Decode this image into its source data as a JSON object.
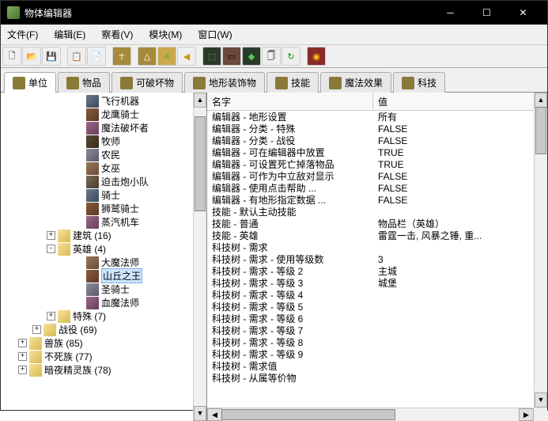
{
  "window": {
    "title": "物体编辑器"
  },
  "menu": {
    "file": "文件(F)",
    "edit": "编辑(E)",
    "view": "察看(V)",
    "module": "模块(M)",
    "window": "窗口(W)"
  },
  "tabs": {
    "unit": "单位",
    "item": "物品",
    "dest": "可破坏物",
    "dood": "地形装饰物",
    "abil": "技能",
    "buff": "魔法效果",
    "upg": "科技"
  },
  "tree": {
    "units": [
      "飞行机器",
      "龙鹰骑士",
      "魔法破坏者",
      "牧师",
      "农民",
      "女巫",
      "迫击炮小队",
      "骑士",
      "狮鹫骑士",
      "蒸汽机车"
    ],
    "build": "建筑  (16)",
    "hero": "英雄  (4)",
    "heroes": [
      "大魔法师",
      "山丘之王",
      "圣骑士",
      "血魔法师"
    ],
    "special": "特殊  (7)",
    "campaign": "战役  (69)",
    "orc": "兽族  (85)",
    "undead": "不死族  (77)",
    "nightelf": "暗夜精灵族  (78)"
  },
  "list": {
    "h_name": "名字",
    "h_val": "值",
    "rows": [
      {
        "n": "编辑器 - 地形设置",
        "v": "所有"
      },
      {
        "n": "编辑器 - 分类 - 特殊",
        "v": "FALSE"
      },
      {
        "n": "编辑器 - 分类 - 战役",
        "v": "FALSE"
      },
      {
        "n": "编辑器 - 可在编辑器中放置",
        "v": "TRUE"
      },
      {
        "n": "编辑器 - 可设置死亡掉落物品",
        "v": "TRUE"
      },
      {
        "n": "编辑器 - 可作为中立敌对显示",
        "v": "FALSE"
      },
      {
        "n": "编辑器 - 使用点击帮助  ...",
        "v": "FALSE"
      },
      {
        "n": "编辑器 - 有地形指定数据  ...",
        "v": "FALSE"
      },
      {
        "n": "技能 - 默认主动技能",
        "v": ""
      },
      {
        "n": "技能 - 普通",
        "v": "物品栏（英雄）"
      },
      {
        "n": "技能 - 英雄",
        "v": "雷霆一击, 风暴之锤, 重..."
      },
      {
        "n": "科技树 - 需求",
        "v": ""
      },
      {
        "n": "科技树 - 需求 - 使用等级数",
        "v": "3"
      },
      {
        "n": "科技树 - 需求 - 等级 2",
        "v": "主城"
      },
      {
        "n": "科技树 - 需求 - 等级 3",
        "v": "城堡"
      },
      {
        "n": "科技树 - 需求 - 等级 4",
        "v": ""
      },
      {
        "n": "科技树 - 需求 - 等级 5",
        "v": ""
      },
      {
        "n": "科技树 - 需求 - 等级 6",
        "v": ""
      },
      {
        "n": "科技树 - 需求 - 等级 7",
        "v": ""
      },
      {
        "n": "科技树 - 需求 - 等级 8",
        "v": ""
      },
      {
        "n": "科技树 - 需求 - 等级 9",
        "v": ""
      },
      {
        "n": "科技树 - 需求值",
        "v": ""
      },
      {
        "n": "科技树 - 从属等价物",
        "v": ""
      }
    ]
  }
}
